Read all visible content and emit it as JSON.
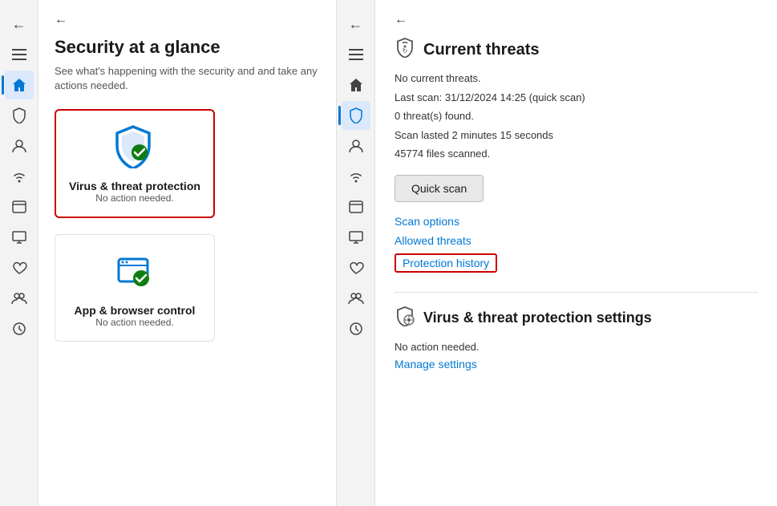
{
  "left_sidebar": {
    "icons": [
      {
        "name": "back",
        "symbol": "←",
        "active": false
      },
      {
        "name": "hamburger",
        "symbol": "☰",
        "active": false
      },
      {
        "name": "home",
        "symbol": "⌂",
        "active": true
      },
      {
        "name": "shield",
        "symbol": "🛡",
        "active": false
      },
      {
        "name": "user",
        "symbol": "👤",
        "active": false
      },
      {
        "name": "wifi",
        "symbol": "((·))",
        "active": false
      },
      {
        "name": "window",
        "symbol": "▣",
        "active": false
      },
      {
        "name": "monitor",
        "symbol": "🖥",
        "active": false
      },
      {
        "name": "health",
        "symbol": "♡",
        "active": false
      },
      {
        "name": "group",
        "symbol": "👥",
        "active": false
      },
      {
        "name": "history",
        "symbol": "🕐",
        "active": false
      }
    ]
  },
  "left_panel": {
    "back_label": "←",
    "title": "Security at a glance",
    "subtitle": "See what's happening with the security and\nand take any actions needed.",
    "cards": [
      {
        "id": "virus",
        "title": "Virus & threat protection",
        "subtitle": "No action needed.",
        "outlined": true
      },
      {
        "id": "app",
        "title": "App & browser control",
        "subtitle": "No action needed.",
        "outlined": false
      }
    ]
  },
  "right_sidebar": {
    "icons": [
      {
        "name": "back",
        "symbol": "←",
        "active": false
      },
      {
        "name": "hamburger",
        "symbol": "☰",
        "active": false
      },
      {
        "name": "home",
        "symbol": "⌂",
        "active": false
      },
      {
        "name": "shield",
        "symbol": "🛡",
        "active": true
      },
      {
        "name": "user",
        "symbol": "👤",
        "active": false
      },
      {
        "name": "wifi",
        "symbol": "((·))",
        "active": false
      },
      {
        "name": "window",
        "symbol": "▣",
        "active": false
      },
      {
        "name": "monitor",
        "symbol": "🖥",
        "active": false
      },
      {
        "name": "health",
        "symbol": "♡",
        "active": false
      },
      {
        "name": "group",
        "symbol": "👥",
        "active": false
      },
      {
        "name": "history",
        "symbol": "🕐",
        "active": false
      }
    ]
  },
  "right_panel": {
    "back_label": "←",
    "current_threats": {
      "section_title": "Current threats",
      "no_threats": "No current threats.",
      "last_scan": "Last scan: 31/12/2024 14:25 (quick scan)",
      "threats_found": "0 threat(s) found.",
      "scan_duration": "Scan lasted 2 minutes 15 seconds",
      "files_scanned": "45774 files scanned.",
      "quick_scan_label": "Quick scan",
      "scan_options_label": "Scan options",
      "allowed_threats_label": "Allowed threats",
      "protection_history_label": "Protection history"
    },
    "threat_settings": {
      "section_title": "Virus & threat protection settings",
      "no_action": "No action needed.",
      "manage_settings_label": "Manage settings"
    }
  }
}
